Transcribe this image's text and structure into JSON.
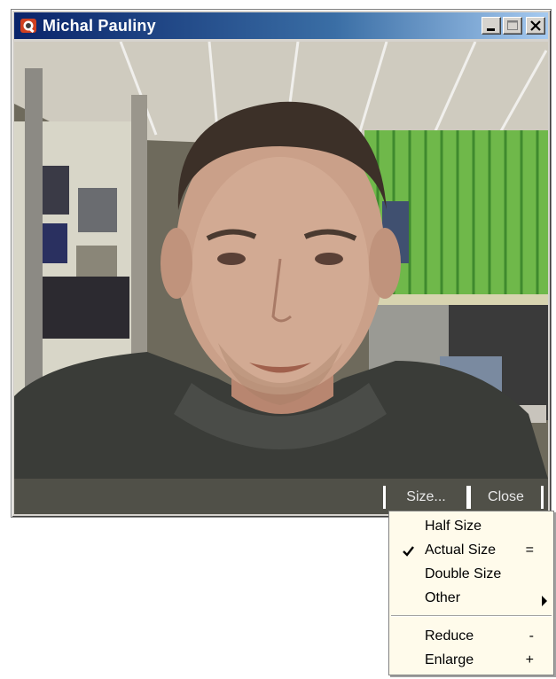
{
  "window": {
    "title": "Michal Pauliny",
    "icon": "webcam-app-icon",
    "buttons": [
      "minimize-icon",
      "maximize-icon",
      "close-icon"
    ]
  },
  "controls": {
    "size_label": "Size...",
    "close_label": "Close"
  },
  "menu": {
    "items": [
      {
        "label": "Half Size",
        "shortcut": "",
        "checked": false
      },
      {
        "label": "Actual Size",
        "shortcut": "=",
        "checked": true
      },
      {
        "label": "Double Size",
        "shortcut": "",
        "checked": false
      },
      {
        "label": "Other",
        "shortcut": "",
        "checked": false,
        "submenu": true
      },
      {
        "label": "Reduce",
        "shortcut": "-",
        "checked": false
      },
      {
        "label": "Enlarge",
        "shortcut": "+",
        "checked": false
      }
    ]
  },
  "colors": {
    "titlebar_start": "#0a246a",
    "titlebar_end": "#a6caf0",
    "control_bar": "#505048",
    "menu_background": "#fffbeb"
  }
}
